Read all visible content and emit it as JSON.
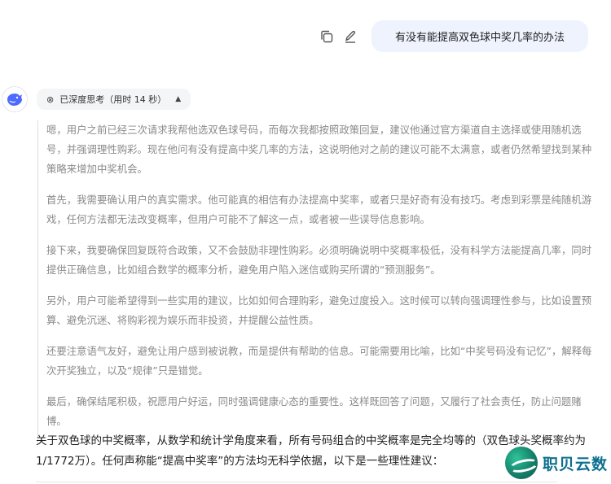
{
  "user_message": {
    "text": "有没有能提高双色球中奖几率的办法"
  },
  "message_actions": {
    "copy_icon": "copy-icon",
    "edit_icon": "edit-icon"
  },
  "assistant": {
    "avatar_icon": "whale-logo-icon",
    "thinking_chip": {
      "label": "已深度思考（用时 14 秒）",
      "expanded": true
    },
    "thinking_paragraphs": [
      "嗯，用户之前已经三次请求我帮他选双色球号码，而每次我都按照政策回复，建议他通过官方渠道自主选择或使用随机选号，并强调理性购彩。现在他问有没有提高中奖几率的方法，这说明他对之前的建议可能不太满意，或者仍然希望找到某种策略来增加中奖机会。",
      "首先，我需要确认用户的真实需求。他可能真的相信有办法提高中奖率，或者只是好奇有没有技巧。考虑到彩票是纯随机游戏，任何方法都无法改变概率，但用户可能不了解这一点，或者被一些误导信息影响。",
      "接下来，我要确保回复既符合政策，又不会鼓励非理性购彩。必须明确说明中奖概率极低，没有科学方法能提高几率，同时提供正确信息，比如组合数学的概率分析，避免用户陷入迷信或购买所谓的“预测服务”。",
      "另外，用户可能希望得到一些实用的建议，比如如何合理购彩，避免过度投入。这时候可以转向强调理性参与，比如设置预算、避免沉迷、将购彩视为娱乐而非投资，并提醒公益性质。",
      "还要注意语气友好，避免让用户感到被说教，而是提供有帮助的信息。可能需要用比喻，比如“中奖号码没有记忆”，解释每次开奖独立，以及“规律”只是错觉。",
      "最后，确保结尾积极，祝愿用户好运，同时强调健康心态的重要性。这样既回答了问题，又履行了社会责任，防止问题赌博。"
    ],
    "answer_text": "关于双色球的中奖概率，从数学和统计学角度来看，所有号码组合的中奖概率是完全均等的（双色球头奖概率约为1/1772万）。任何声称能“提高中奖率”的方法均无科学依据，以下是一些理性建议："
  },
  "watermark": {
    "text": "职贝云数"
  },
  "colors": {
    "accent": "#4d6bfe",
    "bubble": "#eef3fd",
    "thinking_text": "#8a8a8a"
  }
}
